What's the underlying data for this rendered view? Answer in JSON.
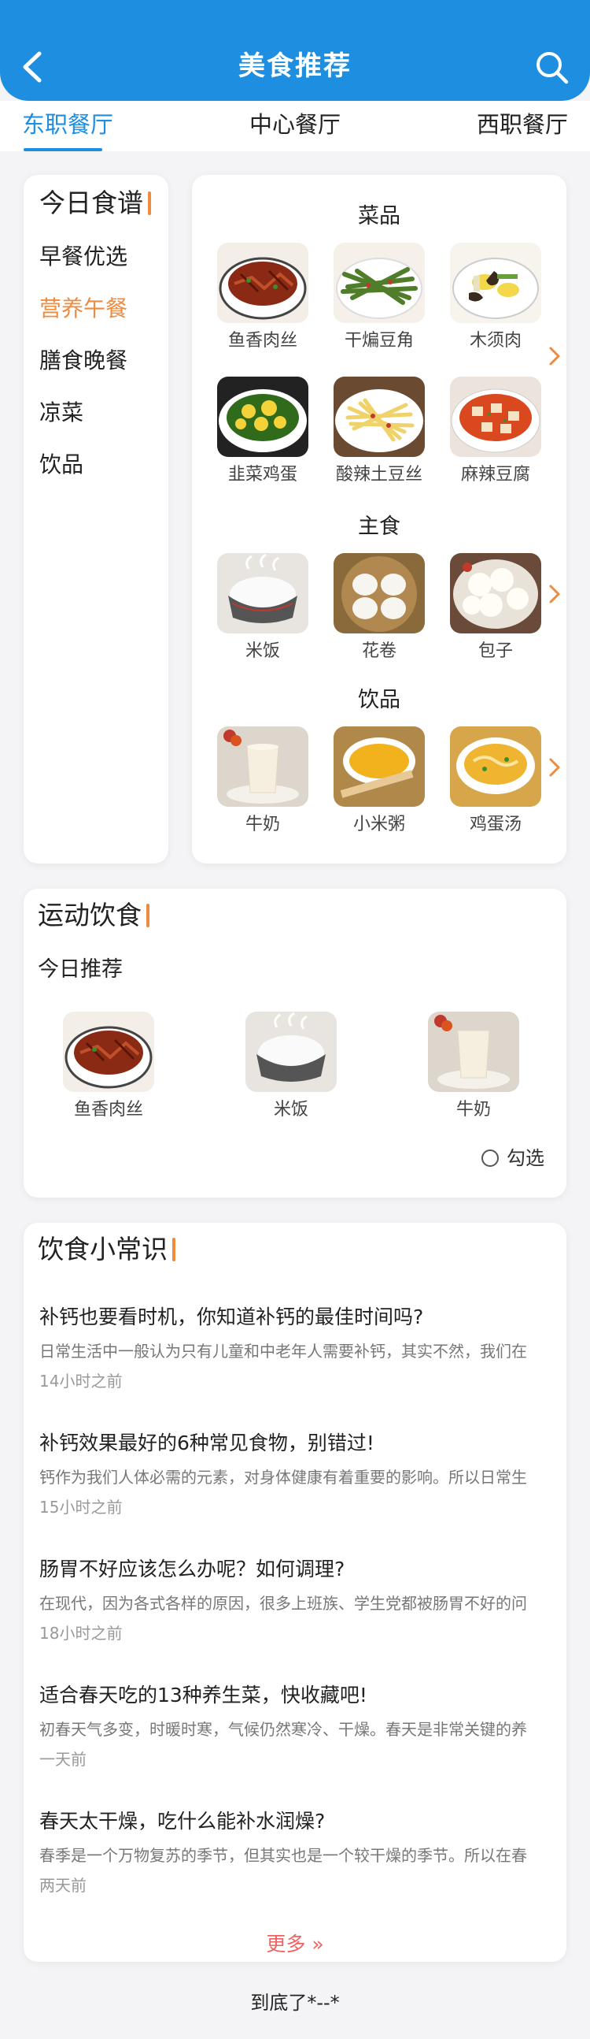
{
  "header": {
    "title": "美食推荐"
  },
  "tabs": [
    {
      "label": "东职餐厅"
    },
    {
      "label": "中心餐厅"
    },
    {
      "label": "西职餐厅"
    }
  ],
  "menu": {
    "title": "今日食谱",
    "items": [
      {
        "label": "早餐优选"
      },
      {
        "label": "营养午餐"
      },
      {
        "label": "膳食晚餐"
      },
      {
        "label": "凉菜"
      },
      {
        "label": "饮品"
      }
    ],
    "active_index": 1
  },
  "dishes": {
    "categories": [
      {
        "title": "菜品",
        "items": [
          {
            "name": "鱼香肉丝"
          },
          {
            "name": "干煸豆角"
          },
          {
            "name": "木须肉"
          },
          {
            "name": "韭菜鸡蛋"
          },
          {
            "name": "酸辣土豆丝"
          },
          {
            "name": "麻辣豆腐"
          }
        ]
      },
      {
        "title": "主食",
        "items": [
          {
            "name": "米饭"
          },
          {
            "name": "花卷"
          },
          {
            "name": "包子"
          }
        ]
      },
      {
        "title": "饮品",
        "items": [
          {
            "name": "牛奶"
          },
          {
            "name": "小米粥"
          },
          {
            "name": "鸡蛋汤"
          }
        ]
      }
    ]
  },
  "sport": {
    "title": "运动饮食",
    "subtitle": "今日推荐",
    "items": [
      {
        "name": "鱼香肉丝"
      },
      {
        "name": "米饭"
      },
      {
        "name": "牛奶"
      }
    ],
    "check_label": "勾选"
  },
  "tips": {
    "title": "饮食小常识",
    "articles": [
      {
        "title": "补钙也要看时机，你知道补钙的最佳时间吗?",
        "summary": "日常生活中一般认为只有儿童和中老年人需要补钙，其实不然，我们在",
        "time": "14小时之前"
      },
      {
        "title": "补钙效果最好的6种常见食物，别错过!",
        "summary": "钙作为我们人体必需的元素，对身体健康有着重要的影响。所以日常生",
        "time": "15小时之前"
      },
      {
        "title": "肠胃不好应该怎么办呢？如何调理?",
        "summary": "在现代，因为各式各样的原因，很多上班族、学生党都被肠胃不好的问",
        "time": "18小时之前"
      },
      {
        "title": "适合春天吃的13种养生菜，快收藏吧!",
        "summary": "初春天气多变，时暖时寒，气候仍然寒冷、干燥。春天是非常关键的养",
        "time": "一天前"
      },
      {
        "title": "春天太干燥，吃什么能补水润燥?",
        "summary": " 春季是一个万物复苏的季节，但其实也是一个较干燥的季节。所以在春",
        "time": "两天前"
      }
    ],
    "more_label": "更多 »"
  },
  "footer": {
    "text": "到底了*--*"
  },
  "colors": {
    "primary": "#1e8fe0",
    "accent": "#f08a3c",
    "more": "#f06262"
  }
}
